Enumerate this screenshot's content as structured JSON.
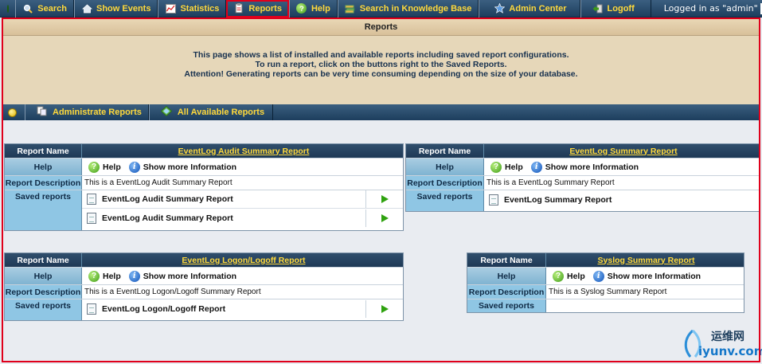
{
  "topnav": {
    "items": [
      {
        "label": "Search",
        "icon": "search-icon"
      },
      {
        "label": "Show Events",
        "icon": "events-icon"
      },
      {
        "label": "Statistics",
        "icon": "statistics-icon"
      },
      {
        "label": "Reports",
        "icon": "reports-icon",
        "active": true
      },
      {
        "label": "Help",
        "icon": "help-icon"
      },
      {
        "label": "Search in Knowledge Base",
        "icon": "knowledge-base-icon"
      },
      {
        "label": "Admin Center",
        "icon": "star-icon"
      },
      {
        "label": "Logoff",
        "icon": "logoff-icon"
      }
    ],
    "logged_in": "Logged in as \"admin\""
  },
  "page": {
    "title": "Reports",
    "info_lines": [
      "This page shows a list of installed and available reports including saved report configurations.",
      "To run a report, click on the buttons right to the Saved Reports.",
      "Attention! Generating reports can be very time consuming depending on the size of your database."
    ]
  },
  "subnav": {
    "items": [
      {
        "label": "Administrate Reports",
        "icon": "administrate-icon"
      },
      {
        "label": "All Available Reports",
        "icon": "reports-list-icon"
      }
    ]
  },
  "labels": {
    "report_name": "Report Name",
    "help": "Help",
    "report_description": "Report Description",
    "saved_reports": "Saved reports",
    "help_link": "Help",
    "show_more": "Show more Information"
  },
  "reports": [
    {
      "name": "EventLog Audit Summary Report",
      "description": "This is a EventLog Audit Summary Report",
      "saved": [
        "EventLog Audit Summary Report",
        "EventLog Audit Summary Report"
      ]
    },
    {
      "name": "EventLog Summary Report",
      "description": "This is a EventLog Summary Report",
      "saved": [
        "EventLog Summary Report"
      ]
    },
    {
      "name": "EventLog Logon/Logoff Report",
      "description": "This is a EventLog Logon/Logoff Summary Report",
      "saved": [
        "EventLog Logon/Logoff Report"
      ]
    },
    {
      "name": "Syslog Summary Report",
      "description": "This is a Syslog Summary Report",
      "saved": []
    }
  ],
  "watermark": {
    "line1": "运维网",
    "line2": "iyunv.com"
  },
  "colors": {
    "nav": "#1d3e5d",
    "nav_text": "#ffd93b",
    "highlight": "#e0001b",
    "label_bg": "#8fc6e4",
    "info_bg": "#e6d7b9"
  }
}
